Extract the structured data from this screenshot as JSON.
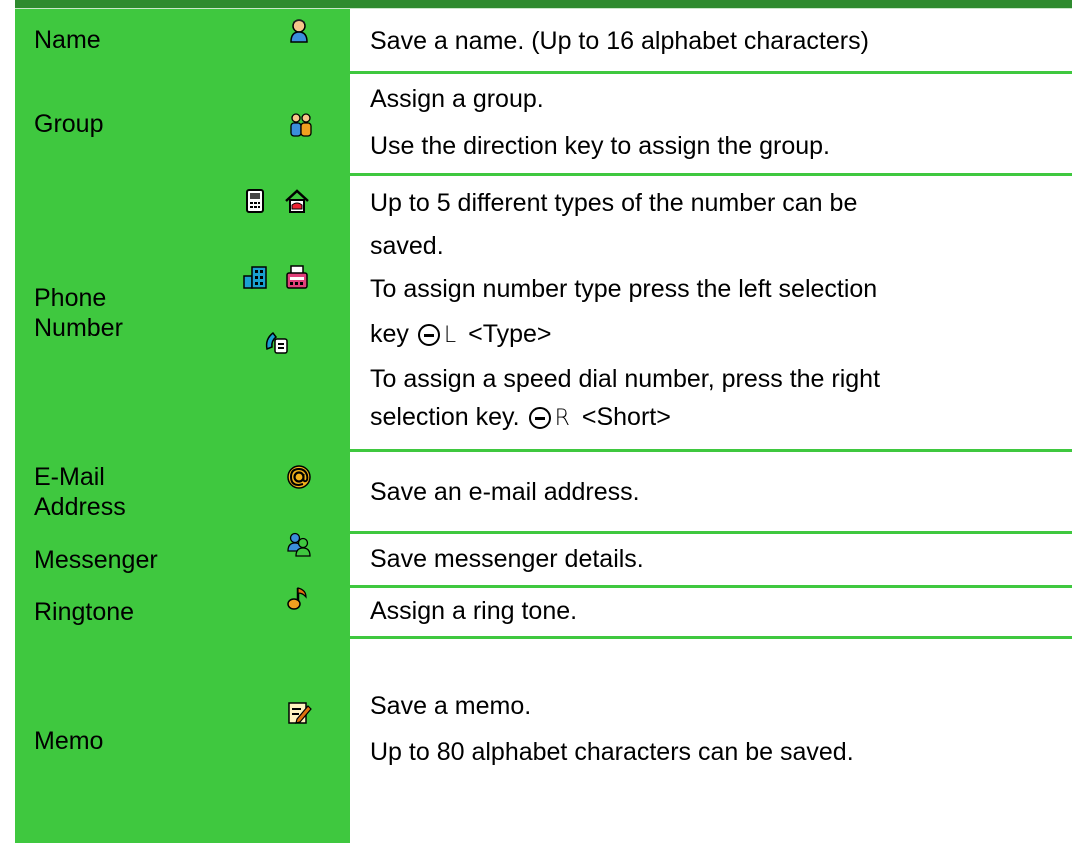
{
  "rows": [
    {
      "label": "Name",
      "icon": "person-icon",
      "lines": [
        "Save a name. (Up to 16 alphabet characters)"
      ]
    },
    {
      "label": "Group",
      "icon": "group-icon",
      "lines": [
        "Assign a group.",
        "Use the direction key to assign the group."
      ]
    },
    {
      "label_lines": [
        "Phone",
        "Number"
      ],
      "icons": [
        "mobile-phone-icon",
        "home-icon",
        "office-icon",
        "fax-icon",
        "general-phone-icon"
      ],
      "lines": [
        "Up to 5 different types of the number can be",
        "saved.",
        "To assign number type press the left selection",
        "To assign a speed dial number, press the right"
      ],
      "key_lines": {
        "left_prefix": "key",
        "left_key": "L",
        "left_label": "<Type>",
        "right_prefix": "selection key.",
        "right_key": "R",
        "right_label": "<Short>"
      }
    },
    {
      "label_lines": [
        "E-Mail",
        "Address"
      ],
      "icon": "at-sign-icon",
      "lines": [
        "Save an e-mail address."
      ]
    },
    {
      "label": "Messenger",
      "icon": "messenger-icon",
      "lines": [
        "Save messenger details."
      ]
    },
    {
      "label": "Ringtone",
      "icon": "music-note-icon",
      "lines": [
        "Assign a ring tone."
      ]
    },
    {
      "label": "Memo",
      "icon": "memo-icon",
      "lines": [
        "Save a memo.",
        "Up to 80 alphabet characters can be saved."
      ]
    }
  ],
  "colors": {
    "header_bar": "#2e8b2e",
    "label_bg": "#3fc83f"
  }
}
